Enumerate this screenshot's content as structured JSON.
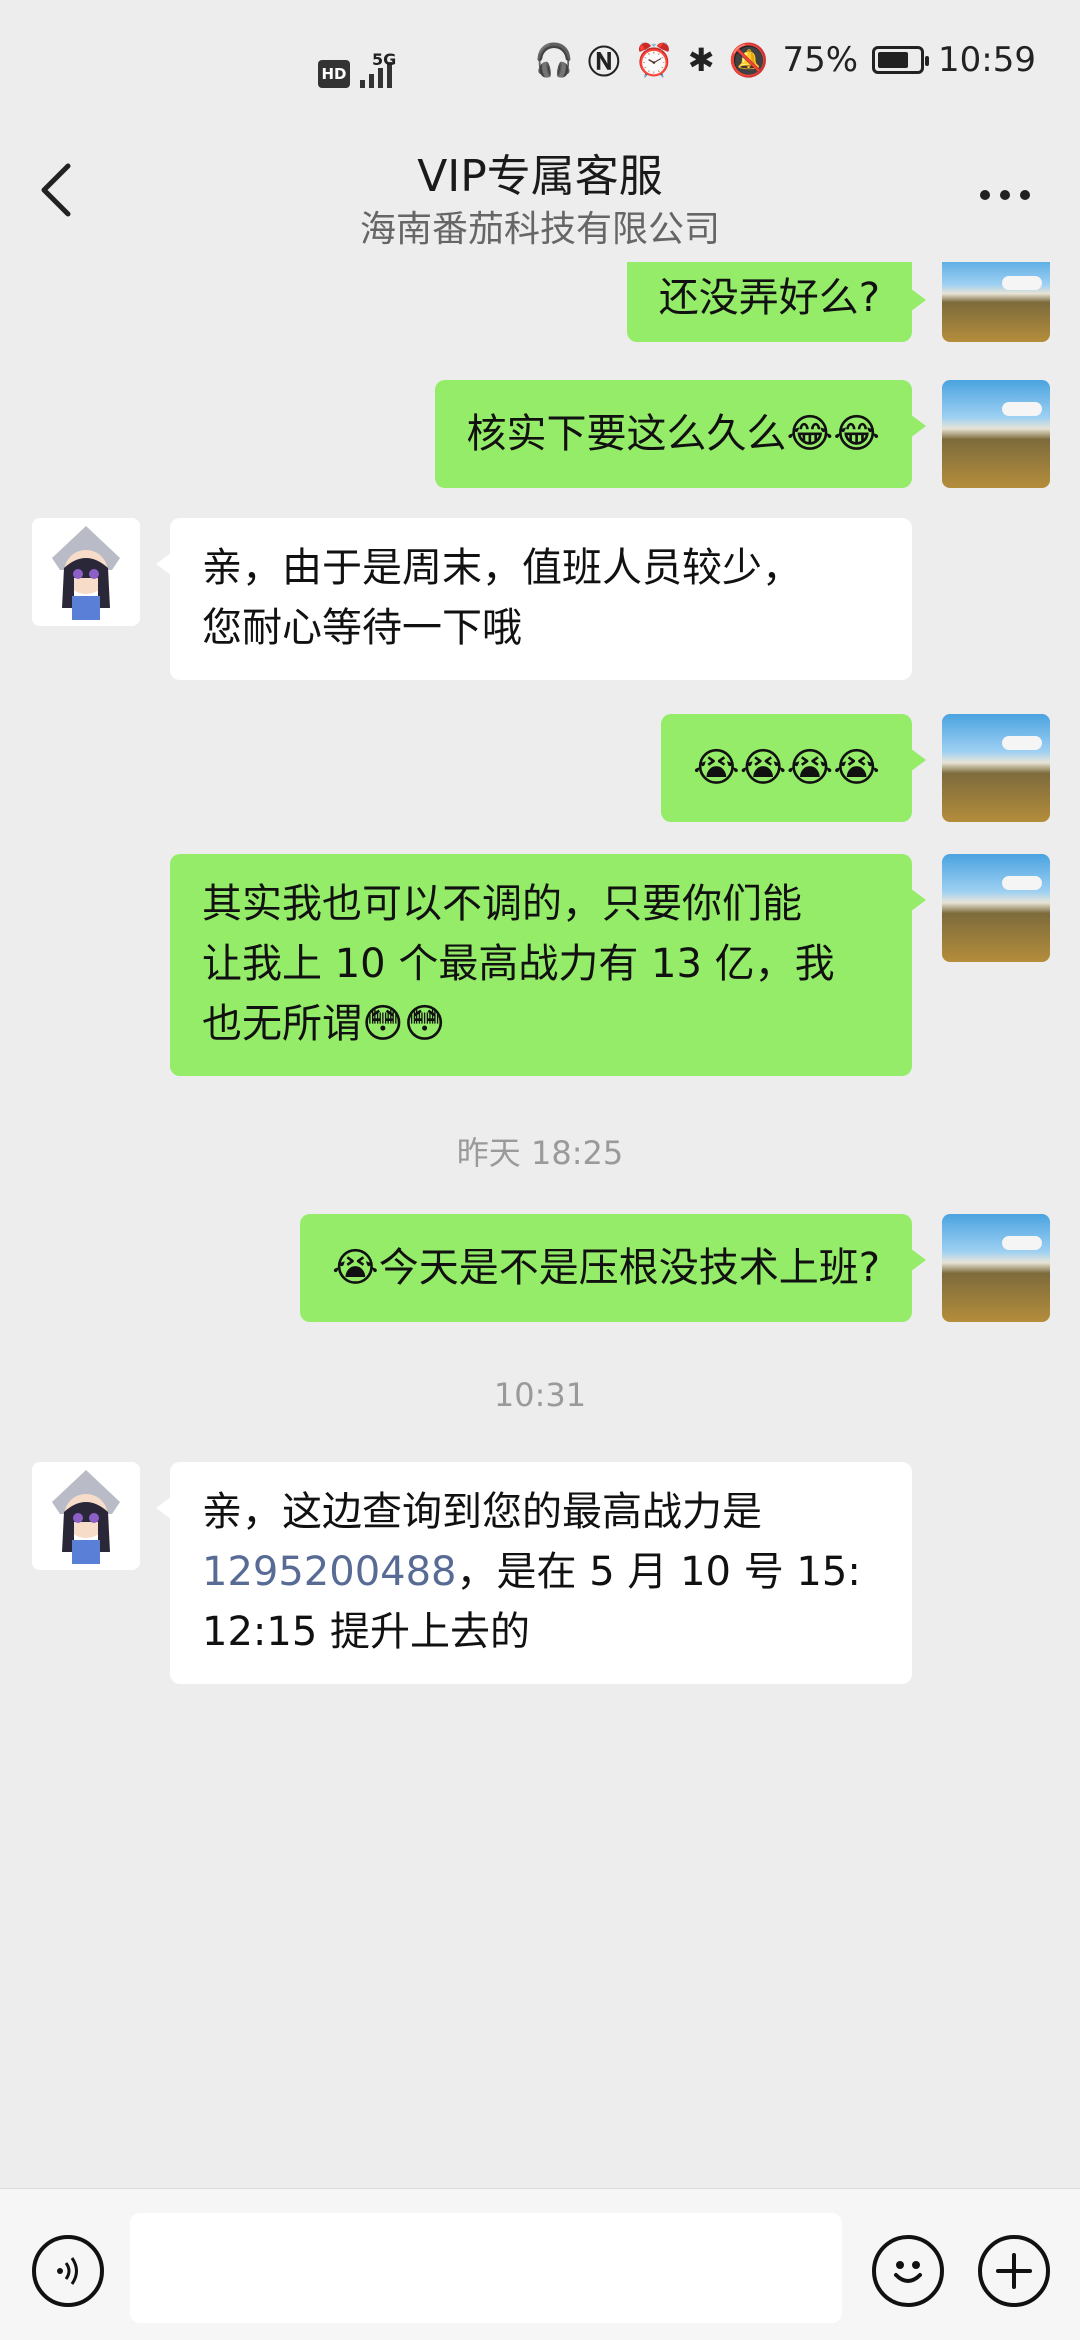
{
  "status_bar": {
    "hd": "HD",
    "network": "5G",
    "battery": "75%",
    "time": "10:59"
  },
  "nav": {
    "title": "VIP专属客服",
    "subtitle": "海南番茄科技有限公司"
  },
  "messages": [
    {
      "from": "me",
      "text": "还没弄好么?"
    },
    {
      "from": "me",
      "text": "核实下要这么久么😂😂"
    },
    {
      "from": "agent",
      "line1": "亲，由于是周末，值班人员较少，",
      "line2": "您耐心等待一下哦"
    },
    {
      "from": "me",
      "text": "😭😭😭😭"
    },
    {
      "from": "me",
      "line1": "其实我也可以不调的，只要你们能",
      "line2": "让我上 10 个最高战力有 13 亿，我",
      "line3": "也无所谓😳😳"
    },
    {
      "from": "me",
      "text": "😭今天是不是压根没技术上班?"
    },
    {
      "from": "agent",
      "line1": "亲，这边查询到您的最高战力是",
      "link": "1295200488",
      "line2_rest": "，是在 5 月 10 号 15:",
      "line3": "12:15 提升上去的"
    }
  ],
  "timestamps": [
    "昨天 18:25",
    "10:31"
  ],
  "input": {
    "placeholder": ""
  },
  "colors": {
    "my_bubble": "#95ec69",
    "agent_bubble": "#ffffff",
    "link": "#576b95",
    "background": "#ededed"
  },
  "icons": [
    "back-chevron-icon",
    "more-dots-icon",
    "voice-icon",
    "emoji-icon",
    "plus-icon"
  ]
}
